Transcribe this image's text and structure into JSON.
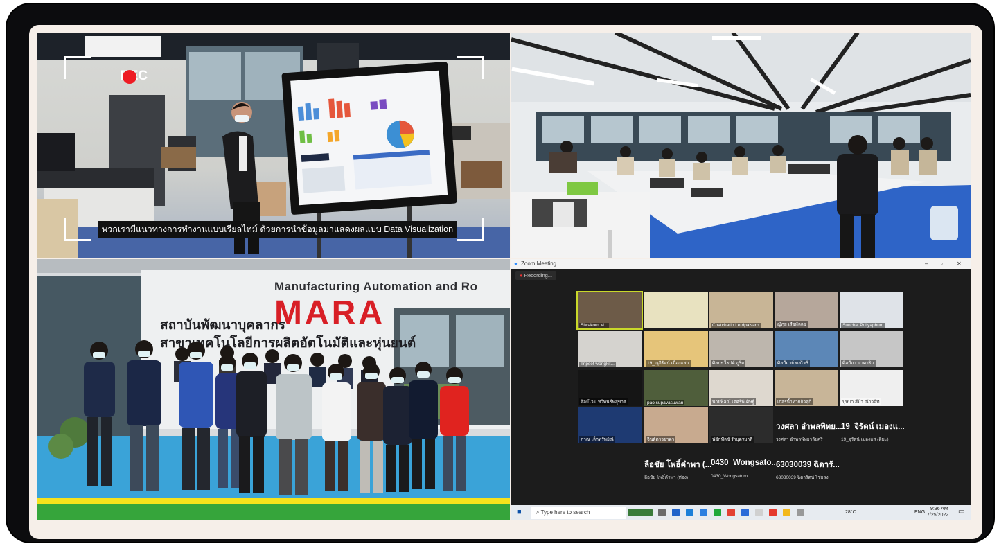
{
  "panel_office": {
    "rec_label": "REC",
    "caption": "พวกเรามีแนวทางการทำงานแบบเรียลไทม์ ด้วยการนำข้อมูลมาแสดงผลแบบ Data Visualization"
  },
  "panel_group": {
    "sign_english": "Manufacturing Automation and Ro",
    "sign_logo": "MARA",
    "sign_thai_line1": "สถาบันพัฒนาบุคลากร",
    "sign_thai_line2": "สาขาเทคโนโลยีการผลิตอัตโนมัติและหุ่นยนต์"
  },
  "panel_zoom": {
    "window_title": "Zoom Meeting",
    "recording_label": "Recording...",
    "participants": [
      {
        "name": "Siwakorn M..."
      },
      {
        "name": ""
      },
      {
        "name": "Chatcharin Lerdpaisarn"
      },
      {
        "name": "ญิภุย เสือพัลลย"
      },
      {
        "name": "Sunchai Poliyaphum"
      },
      {
        "name": "Tripset wongkit..."
      },
      {
        "name": "19_ณุจิรัตน์ เมืองแสน"
      },
      {
        "name": "ศิลปะ ไรปต์ ภูริต"
      },
      {
        "name": "ศิลป์มาย์ พลไทริ"
      },
      {
        "name": "ศิลป์ถา นาคาริม"
      },
      {
        "name": "ลิลย์ไวน ทวีพนธ์พสุขาล"
      },
      {
        "name": "pao supavasuwan"
      },
      {
        "name": "นายฟิลณ์ เตศรีพิเศิษฐ์"
      },
      {
        "name": "เกสรน้ำทวยกิจสุกิ"
      },
      {
        "name": "บุษบา สีม้า ณ้าวดีท"
      },
      {
        "name": "ภาณ เล็กทรัพย์ณ์"
      },
      {
        "name": "จินต์ดาวยาดา"
      },
      {
        "name": "ฟอิกฟัลซ์ รำบุตรมาลี"
      },
      {
        "name": "วงศลา อำพลพิทย..."
      },
      {
        "name": "19_จิรัตน์ เมองแ..."
      },
      {
        "name": "ลือชัย โพธิ์คำพา (..."
      },
      {
        "name": "0430_Wongsato..."
      },
      {
        "name": "63030039 ฉิดารั..."
      }
    ],
    "big_names": [
      "วงศลา อำพลพิทย...",
      "19_จิรัตน์ เมองแ...",
      "ลือชัย โพธิ์คำพา (...",
      "0430_Wongsato...",
      "63030039 ฉิดารั..."
    ],
    "big_sub": [
      "วงศลา อำพลพิทยาลัยศรี",
      "19_จุรัตน์ เมองแส (ดีมะ)",
      "ลือชัย โพธิ์คำพา (ท่อง)",
      "0430_Wongsatorn",
      "63030039 ฉิดารัตน์ ไชยลง"
    ],
    "taskbar": {
      "search_placeholder": "Type here to search",
      "weather": "28°C",
      "lang": "ENG",
      "time": "9:36 AM",
      "date": "7/25/2022"
    }
  },
  "colors": {
    "frame": "#0c0c0e",
    "mat": "#f6efe9",
    "rec_dot": "#ee1c24",
    "mara_red": "#d81f26",
    "zoom_bg": "#1c1c1c",
    "active_speaker": "#c9d82a"
  }
}
